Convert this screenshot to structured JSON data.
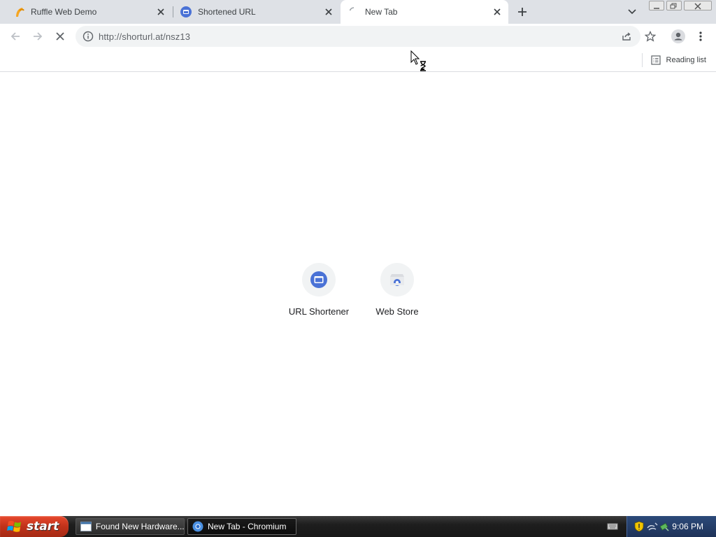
{
  "tabs": [
    {
      "title": "Ruffle Web Demo",
      "icon": "ruffle-icon"
    },
    {
      "title": "Shortened URL",
      "icon": "url-shortener-icon"
    },
    {
      "title": "New Tab",
      "icon": "loading-spinner-icon",
      "active": true
    }
  ],
  "toolbar": {
    "url": "http://shorturl.at/nsz13"
  },
  "bookmark_bar": {
    "reading_list_label": "Reading list"
  },
  "shortcuts": [
    {
      "label": "URL Shortener",
      "icon": "url-shortener-icon"
    },
    {
      "label": "Web Store",
      "icon": "web-store-icon"
    }
  ],
  "taskbar": {
    "start_label": "start",
    "tasks": [
      {
        "label": "Found New Hardware..."
      },
      {
        "label": "New Tab - Chromium"
      }
    ],
    "clock": "9:06 PM"
  },
  "colors": {
    "tab_strip": "#dee1e6",
    "accent_blue": "#4a72d6",
    "taskbar_start": "#c0321a",
    "tray": "#1e3258"
  }
}
